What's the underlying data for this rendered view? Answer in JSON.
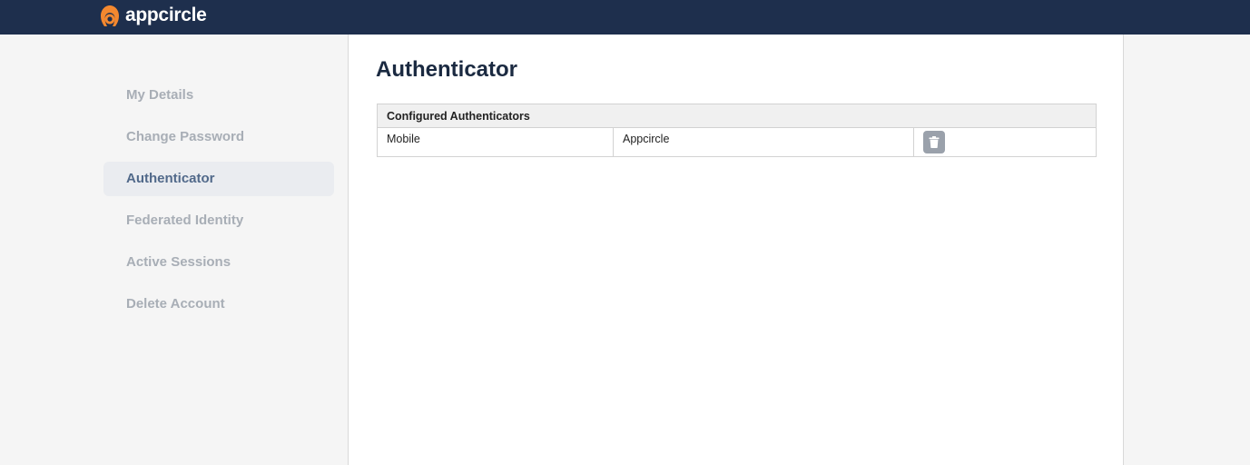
{
  "brand": {
    "name": "appcircle",
    "accent": "#f3882f",
    "topbar_bg": "#1e2f4d"
  },
  "sidebar": {
    "items": [
      {
        "label": "My Details",
        "active": false
      },
      {
        "label": "Change Password",
        "active": false
      },
      {
        "label": "Authenticator",
        "active": true
      },
      {
        "label": "Federated Identity",
        "active": false
      },
      {
        "label": "Active Sessions",
        "active": false
      },
      {
        "label": "Delete Account",
        "active": false
      }
    ]
  },
  "main": {
    "title": "Authenticator",
    "table": {
      "header": "Configured Authenticators",
      "rows": [
        {
          "type": "Mobile",
          "name": "Appcircle",
          "action_icon": "trash-icon"
        }
      ]
    }
  }
}
